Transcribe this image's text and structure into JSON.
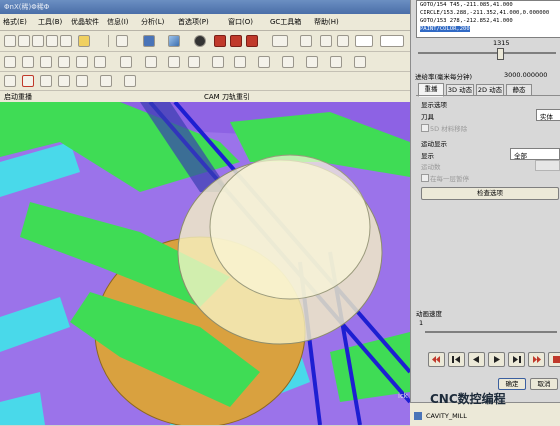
{
  "window": {
    "title": "ΦnX(稀)Φ稀Φ"
  },
  "menubar": {
    "items": [
      "格式(E)",
      "工具(B)",
      "优晶软件",
      "信息(I)",
      "分析(L)",
      "首选项(P)",
      "窗口(O)",
      "GC工具箱",
      "帮助(H)"
    ]
  },
  "toolbar_lower": {
    "selection_filter": "启动重播"
  },
  "viewport": {
    "title": "CAM 刀轨重引"
  },
  "gcode": {
    "lines": [
      "GOTO/154 T45,-211.085,41.000",
      "CIRCLE/153.288,-211.352,41.000,0.000000",
      "GOTO/153 278,-212.852,41.000",
      "PAINT/COLOR,200"
    ],
    "selected_index": 3
  },
  "playback": {
    "step_value": "1315",
    "feedrate_label": "进给率(毫米每分钟)",
    "feedrate_value": "3000.000000",
    "tabs": [
      "重播",
      "3D 动态",
      "2D 动态",
      "静态"
    ],
    "display_options_label": "显示选项",
    "tool_label": "刀具",
    "tool_value": "实体",
    "show_tool_label": "5D 材料移除",
    "motion_display_label": "运动显示",
    "display_label": "显示",
    "display_value": "全部",
    "motion_count_label": "运动数",
    "single_step_label": "在每一层暂停",
    "check_options_label": "检查选项",
    "anim_speed_label": "动画速度",
    "anim_speed_min": "1",
    "ok_label": "确定",
    "cancel_label": "取消"
  },
  "bottom_panel": {
    "item": "CAVITY_MILL",
    "click_label": "ick"
  },
  "watermark": {
    "text": "CNC数控编程"
  },
  "colors": {
    "viewport_bg": "#9b73ea",
    "toolpath_green": "#3fdc55",
    "stock_cyan": "#49d9ea",
    "selection_blue": "#316ac5"
  }
}
